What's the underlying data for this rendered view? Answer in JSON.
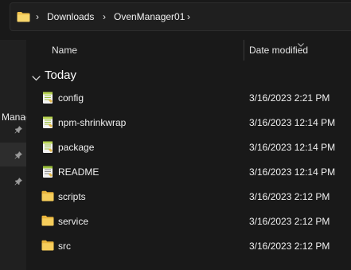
{
  "address_bar": {
    "crumbs": [
      "Downloads",
      "OvenManager01"
    ],
    "separator": "›"
  },
  "nav_pane": {
    "partial_label": "l Manag"
  },
  "columns": {
    "name": "Name",
    "date_modified": "Date modified"
  },
  "group": {
    "label": "Today"
  },
  "files": [
    {
      "name": "config",
      "date": "3/16/2023 2:21 PM",
      "icon": "json-file-icon"
    },
    {
      "name": "npm-shrinkwrap",
      "date": "3/16/2023 12:14 PM",
      "icon": "json-file-icon"
    },
    {
      "name": "package",
      "date": "3/16/2023 12:14 PM",
      "icon": "json-file-icon"
    },
    {
      "name": "README",
      "date": "3/16/2023 12:14 PM",
      "icon": "markdown-file-icon"
    },
    {
      "name": "scripts",
      "date": "3/16/2023 2:12 PM",
      "icon": "folder-icon"
    },
    {
      "name": "service",
      "date": "3/16/2023 2:12 PM",
      "icon": "folder-icon"
    },
    {
      "name": "src",
      "date": "3/16/2023 2:12 PM",
      "icon": "folder-icon"
    }
  ],
  "colors": {
    "background": "#191919",
    "folder": "#f0c24d",
    "file_icon": "#b6d34f"
  }
}
